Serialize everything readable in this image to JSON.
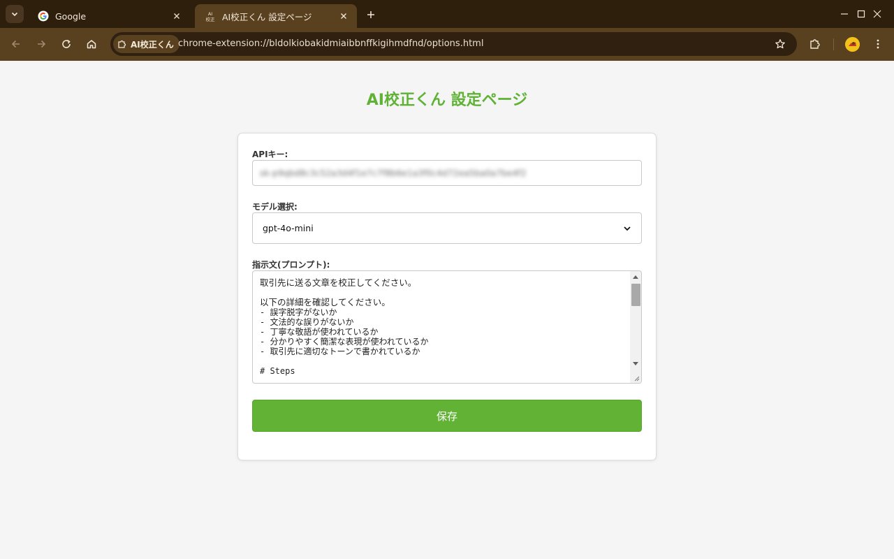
{
  "browser": {
    "tabs": [
      {
        "title": "Google",
        "favicon": "google-icon",
        "active": false
      },
      {
        "title": "AI校正くん 設定ページ",
        "favicon": "ai-koseikun-icon",
        "active": true
      }
    ],
    "favicon_text": [
      "AI",
      "校正"
    ],
    "omnibox": {
      "chip_label": "AI校正くん",
      "url": "chrome-extension://bldolkiobakidmiaibbnffkigihmdfnd/options.html"
    }
  },
  "page": {
    "title": "AI校正くん 設定ページ",
    "api_key": {
      "label": "APIキー:",
      "value_masked": "sk-p9qbd8c3c52a3d4f1e7c7f8b6e1a3f0c4d72ea5ba0a7be4f2"
    },
    "model": {
      "label": "モデル選択:",
      "selected": "gpt-4o-mini"
    },
    "prompt": {
      "label": "指示文(プロンプト):",
      "lines": [
        "取引先に送る文章を校正してください。",
        "",
        "以下の詳細を確認してください。",
        "- 誤字脱字がないか",
        "- 文法的な誤りがないか",
        "- 丁寧な敬語が使われているか",
        "- 分かりやすく簡潔な表現が使われているか",
        "- 取引先に適切なトーンで書かれているか",
        "",
        "# Steps"
      ]
    },
    "save_label": "保存"
  },
  "colors": {
    "accent": "#62b335",
    "title": "#5fb236",
    "frame": "#2e1f0d",
    "toolbar": "#59401f"
  }
}
